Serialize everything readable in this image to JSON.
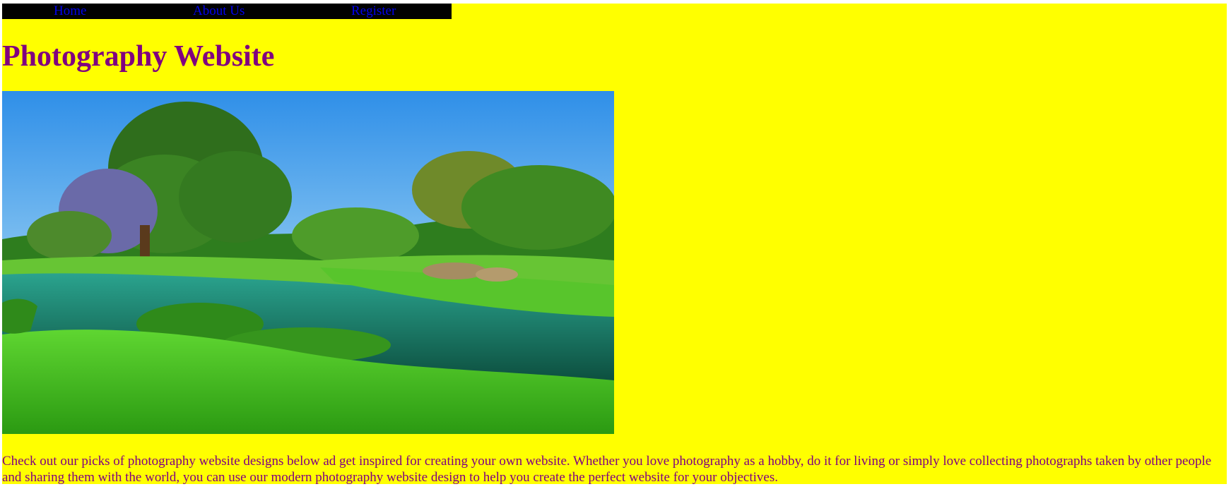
{
  "nav": {
    "items": [
      {
        "label": "Home"
      },
      {
        "label": "About Us"
      },
      {
        "label": "Register"
      }
    ]
  },
  "page": {
    "title": "Photography Website",
    "description": "Check out our picks of photography website designs below ad get inspired for creating your own website. Whether you love photography as a hobby, do it for living or simply love collecting photographs taken by other people and sharing them with the world, you can use our modern photography website design to help you create the perfect website for your objectives."
  },
  "colors": {
    "background": "#ffff00",
    "nav_background": "#000000",
    "link": "#0000ee",
    "text": "#800080"
  }
}
